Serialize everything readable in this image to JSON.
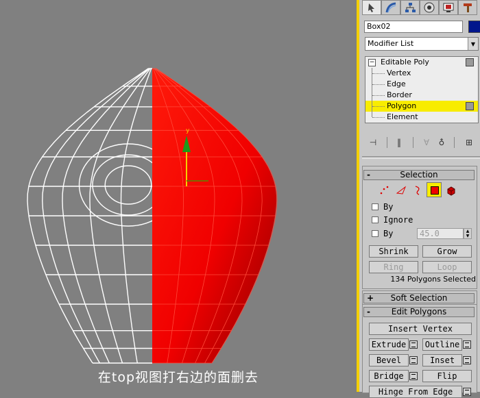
{
  "viewport": {
    "caption": "在top视图打右边的面删去",
    "gizmo_axis_label": "y",
    "wire_color": "#ffffff",
    "mesh_color": "#ff0000"
  },
  "tabs": [
    {
      "icon": "create-arrow-icon"
    },
    {
      "icon": "modify-icon"
    },
    {
      "icon": "hierarchy-icon"
    },
    {
      "icon": "motion-icon"
    },
    {
      "icon": "display-icon"
    },
    {
      "icon": "utilities-hammer-icon"
    }
  ],
  "object": {
    "name": "Box02",
    "color": "#00168c"
  },
  "modifier_list": {
    "label": "Modifier List"
  },
  "stack": {
    "items": [
      "Editable Poly",
      "Vertex",
      "Edge",
      "Border",
      "Polygon",
      "Element"
    ],
    "selected": "Polygon"
  },
  "selection": {
    "title": "Selection",
    "by_vertex_label": "By",
    "ignore_backfacing_label": "Ignore",
    "by_angle_label": "By",
    "angle_value": "45.0",
    "shrink_label": "Shrink",
    "grow_label": "Grow",
    "ring_label": "Ring",
    "loop_label": "Loop",
    "status": "134 Polygons Selected"
  },
  "soft_selection": {
    "title": "Soft Selection"
  },
  "edit_polygons": {
    "title": "Edit Polygons",
    "insert_vertex": "Insert Vertex",
    "extrude": "Extrude",
    "outline": "Outline",
    "bevel": "Bevel",
    "inset": "Inset",
    "bridge": "Bridge",
    "flip": "Flip",
    "hinge": "Hinge From Edge"
  }
}
